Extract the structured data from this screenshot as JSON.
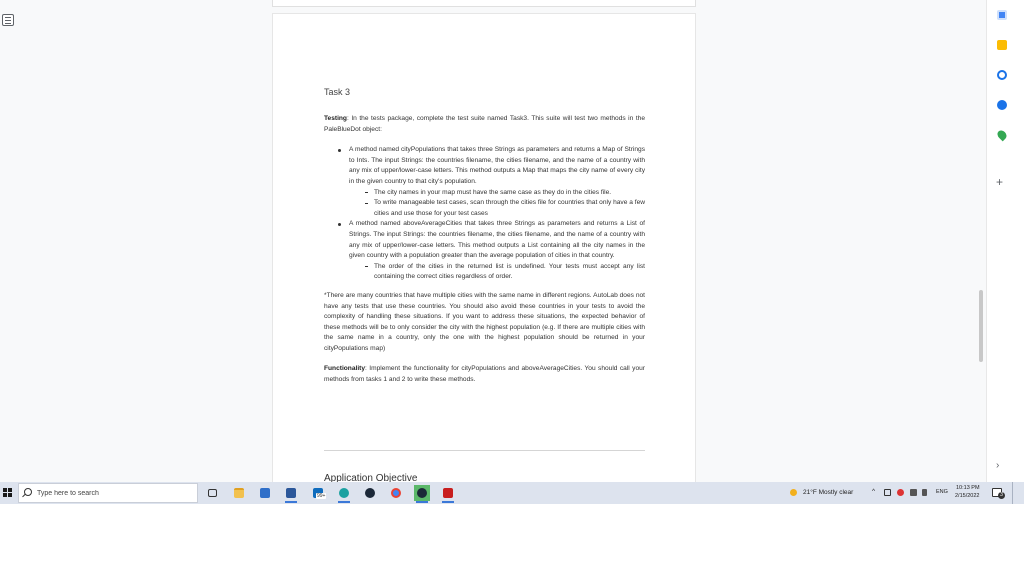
{
  "document": {
    "heading": "Task 3",
    "testing_label": "Testing",
    "testing_text": ": In the tests package, complete the test suite named Task3. This suite will test two methods in the PaleBlueDot object:",
    "bullets": [
      {
        "text": "A method named cityPopulations that takes three Strings as parameters and returns a Map of Strings to Ints. The input Strings: the countries filename, the cities filename, and the name of a country with any mix of upper/lower-case letters. This method outputs a Map that maps the city name of every city in the given country to that city's population.",
        "sub": [
          "The city names in your map must have the same case as they do in the cities file.",
          "To write manageable test cases, scan through the cities file for countries that only have a few cities and use those for your test cases"
        ]
      },
      {
        "text": "A method named aboveAverageCities that takes three Strings as parameters and returns a List of Strings. The input Strings: the countries filename, the cities filename, and the name of a country with any mix of upper/lower-case letters. This method outputs a List containing all the city names in the given country with a population greater than the average population of cities in that country.",
        "sub": [
          "The order of the cities in the returned list is undefined. Your tests must accept any list containing the correct cities regardless of order."
        ]
      }
    ],
    "note": "*There are many countries that have multiple cities with the same name in different regions. AutoLab does not have any tests that use these countries. You should also avoid these countries in your tests to avoid the complexity of handling these situations. If you want to address these situations, the expected behavior of these methods will be to only consider the city with the highest population (e.g. If there are multiple cities with the same name in a country, only the one with the highest population should be returned in your cityPopulations map)",
    "functionality_label": "Functionality",
    "functionality_text": ": Implement the functionality for cityPopulations and aboveAverageCities. You should call your methods from tasks 1 and 2 to write these methods.",
    "next_heading": "Application Objective"
  },
  "taskbar": {
    "search_placeholder": "Type here to search",
    "mail_badge": "99+",
    "weather": "21°F  Mostly clear",
    "language": "ENG",
    "time": "10:13 PM",
    "date": "2/15/2022",
    "notification_count": "3"
  },
  "colors": {
    "taskbar_bg": "#dde3ee",
    "page_bg": "#ffffff",
    "accent": "#3b78d8"
  }
}
